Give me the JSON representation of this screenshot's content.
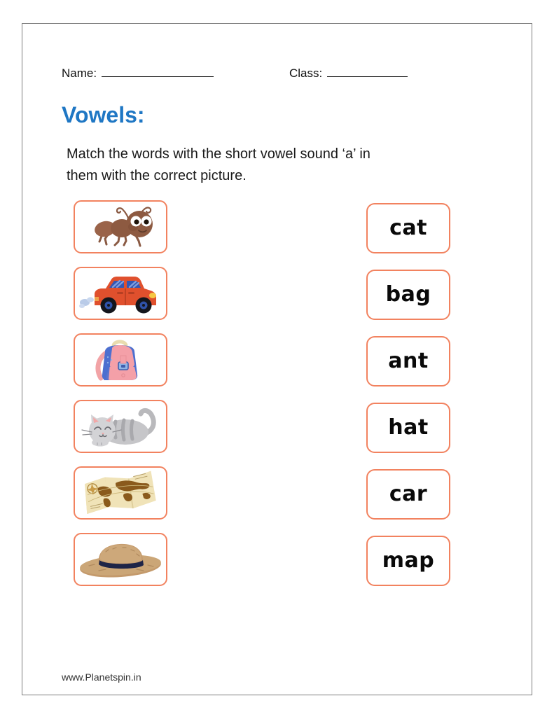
{
  "worksheet": {
    "header": {
      "name_label": "Name:",
      "class_label": "Class:"
    },
    "title": "Vowels:",
    "title_color": "#1f77c4",
    "instructions": {
      "line1": "Match the words with the short vowel sound ‘a’ in",
      "line2": "them with the correct picture."
    },
    "box_border_color": "#f2825f",
    "pictures": [
      {
        "name": "ant",
        "alt": "ant-illustration"
      },
      {
        "name": "car",
        "alt": "car-illustration"
      },
      {
        "name": "bag",
        "alt": "backpack-illustration"
      },
      {
        "name": "cat",
        "alt": "cat-illustration"
      },
      {
        "name": "map",
        "alt": "map-illustration"
      },
      {
        "name": "hat",
        "alt": "hat-illustration"
      }
    ],
    "words": [
      {
        "text": "cat"
      },
      {
        "text": "bag"
      },
      {
        "text": "ant"
      },
      {
        "text": "hat"
      },
      {
        "text": "car"
      },
      {
        "text": "map"
      }
    ],
    "footer": "www.Planetspin.in"
  }
}
